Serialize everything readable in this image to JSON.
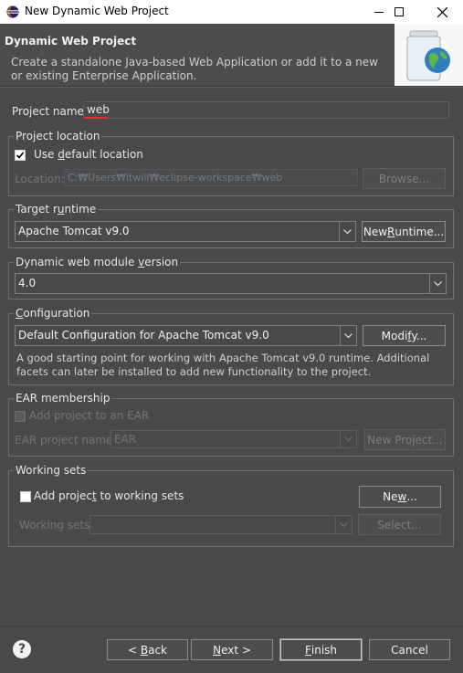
{
  "window": {
    "title": "New Dynamic Web Project",
    "minimize_glyph": "—",
    "maximize_glyph": "☐",
    "close_glyph": "✕"
  },
  "banner": {
    "heading": "Dynamic Web Project",
    "description": "Create a standalone Java-based Web Application or add it to a new or existing Enterprise Application."
  },
  "project_name": {
    "label": "Project name:",
    "value": "web"
  },
  "project_location": {
    "group_label": "Project location",
    "use_default_label_pre": "Use ",
    "use_default_label_mn": "d",
    "use_default_label_post": "efault location",
    "use_default_checked": true,
    "location_label": "Location:",
    "location_value": "C:₩Users₩itwill₩eclipse-workspace₩web",
    "browse_label": "Browse..."
  },
  "target_runtime": {
    "group_label_pre": "Target r",
    "group_label_mn": "u",
    "group_label_post": "ntime",
    "selected": "Apache Tomcat v9.0",
    "new_runtime_pre": "New ",
    "new_runtime_mn": "R",
    "new_runtime_post": "untime..."
  },
  "module_version": {
    "group_label_pre": "Dynamic web module ",
    "group_label_mn": "v",
    "group_label_post": "ersion",
    "selected": "4.0"
  },
  "configuration": {
    "group_label_pre": "",
    "group_label_mn": "C",
    "group_label_post": "onfiguration",
    "selected": "Default Configuration for Apache Tomcat v9.0",
    "modify_pre": "Modi",
    "modify_mn": "f",
    "modify_post": "y...",
    "description": "A good starting point for working with Apache Tomcat v9.0 runtime. Additional facets can later be installed to add new functionality to the project."
  },
  "ear": {
    "group_label": "EAR membership",
    "add_label": "Add project to an EAR",
    "add_checked": false,
    "project_name_label": "EAR project name:",
    "project_name_value": "EAR",
    "new_project_label": "New Project..."
  },
  "working_sets": {
    "group_label": "Working sets",
    "add_label_pre": "Add projec",
    "add_label_mn": "t",
    "add_label_post": " to working sets",
    "add_checked": false,
    "new_pre": "Ne",
    "new_mn": "w",
    "new_post": "...",
    "sets_label": "Working sets:",
    "select_label": "Select..."
  },
  "footer": {
    "help_glyph": "?",
    "back_pre": "< ",
    "back_mn": "B",
    "back_post": "ack",
    "next_pre": "",
    "next_mn": "N",
    "next_post": "ext >",
    "finish_pre": "",
    "finish_mn": "F",
    "finish_post": "inish",
    "cancel_label": "Cancel"
  },
  "colors": {
    "background": "#47494b",
    "accent_underline": "#e03030",
    "globe": "#2f7fc0"
  }
}
